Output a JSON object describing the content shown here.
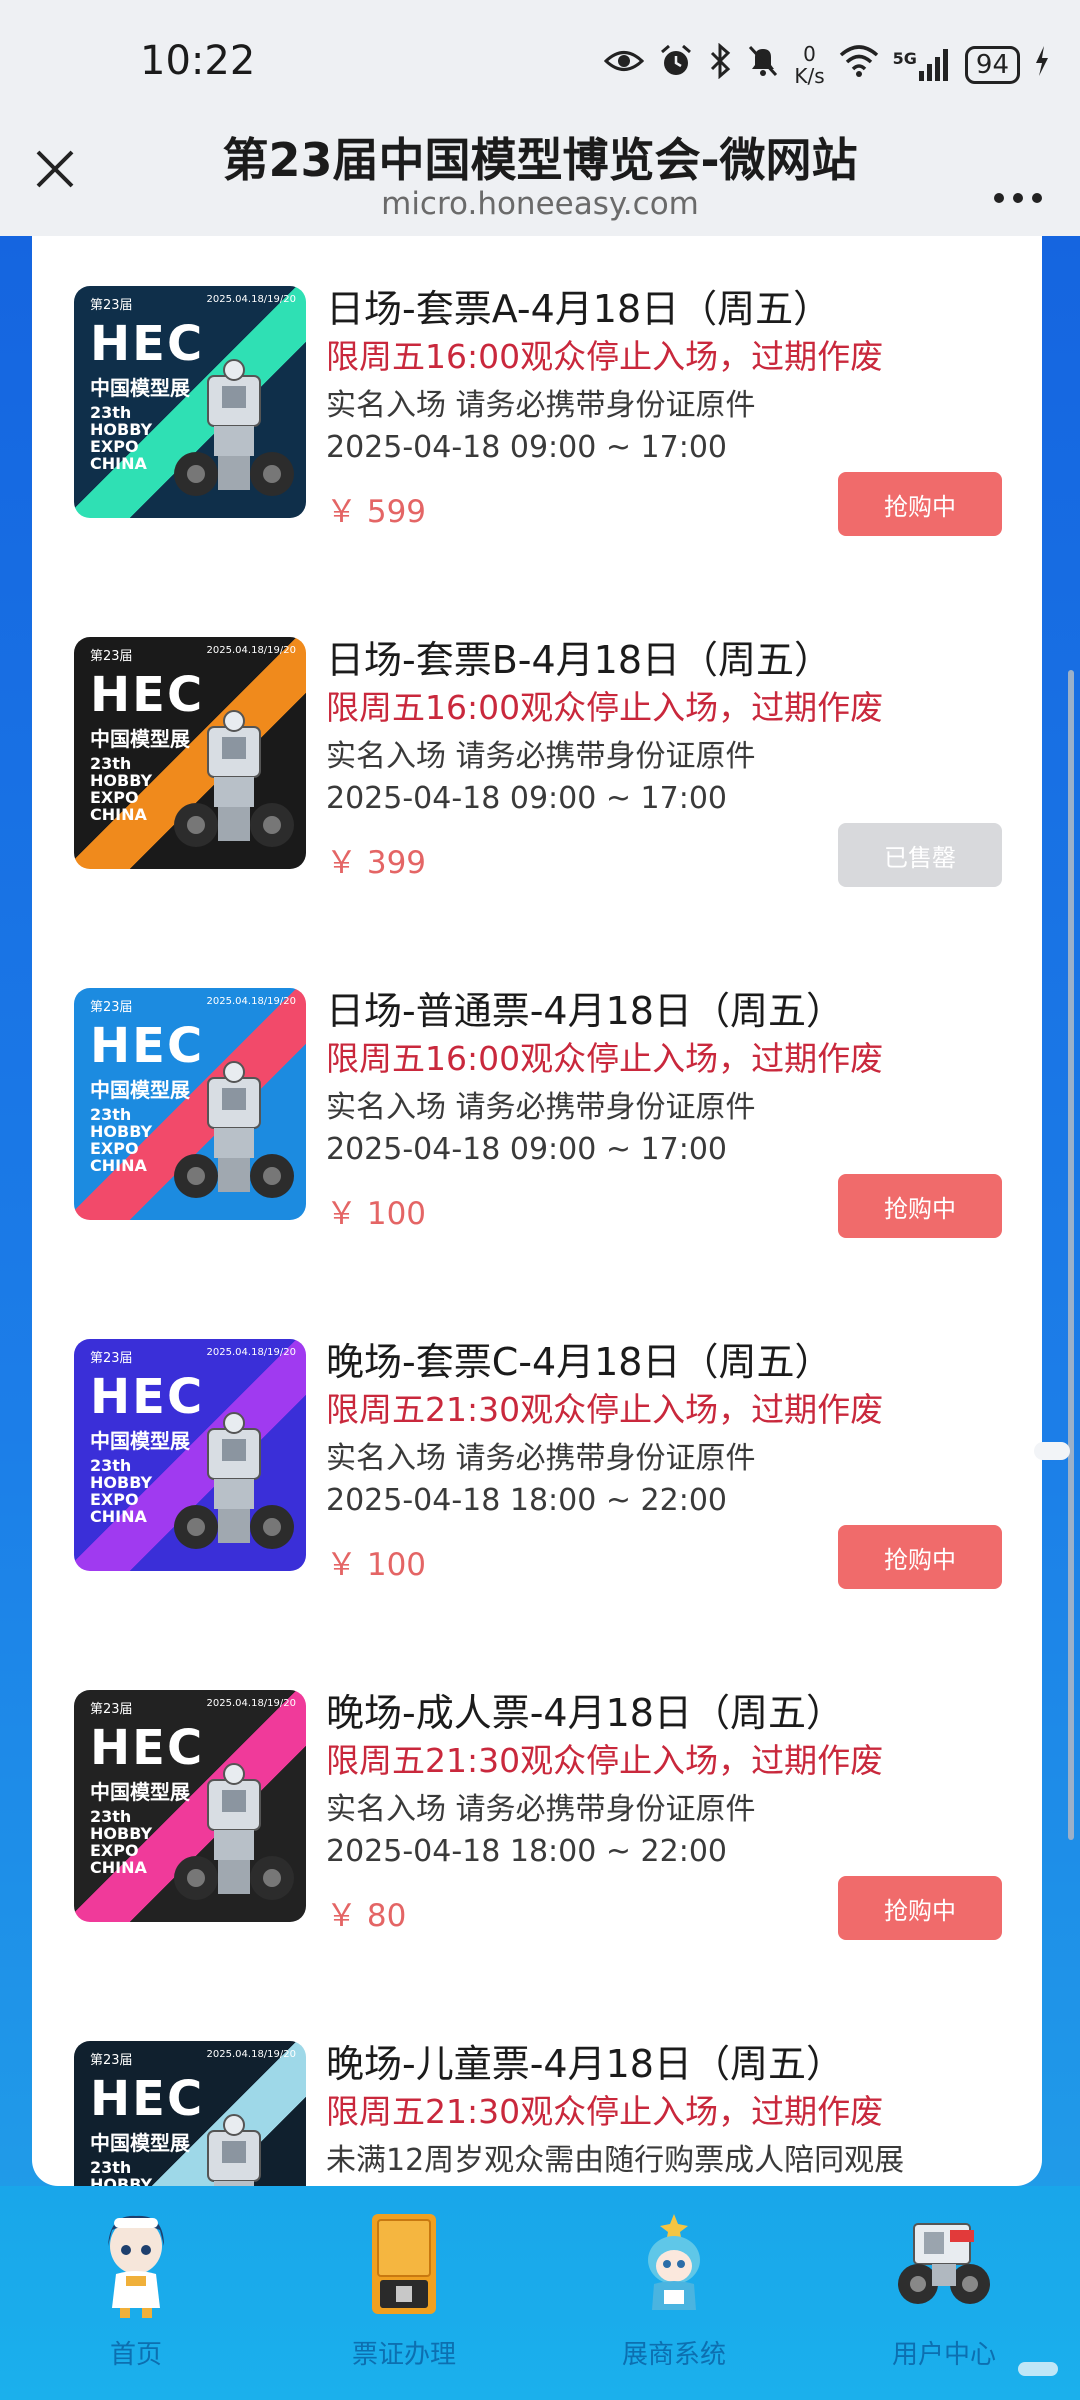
{
  "status_bar": {
    "time": "10:22",
    "net_speed_value": "0",
    "net_speed_unit": "K/s",
    "network_label": "5G",
    "battery": "94",
    "icons": [
      "eye-icon",
      "alarm-icon",
      "bluetooth-icon",
      "mute-icon",
      "wifi-icon",
      "signal-icon",
      "charging-icon"
    ]
  },
  "header": {
    "title": "第23届中国模型博览会-微网站",
    "subtitle": "micro.honeeasy.com"
  },
  "thumbnail": {
    "edition": "第23届",
    "brand": "HEC",
    "brand_cn": "中国模型展",
    "lines": [
      "23th",
      "HOBBY",
      "EXPO",
      "CHINA"
    ],
    "date": "2025.04.18/19/20"
  },
  "tickets": [
    {
      "name": "日场-套票A-4月18日（周五）",
      "notice": "限周五16:00观众停止入场，过期作废",
      "desc": "实名入场 请务必携带身份证原件",
      "datetime": "2025-04-18 09:00 ~ 17:00",
      "price": "￥ 599",
      "button": "抢购中",
      "sold": false,
      "theme": {
        "bg": "#0f2f4a",
        "accent": "#2fe0b4"
      }
    },
    {
      "name": "日场-套票B-4月18日（周五）",
      "notice": "限周五16:00观众停止入场，过期作废",
      "desc": "实名入场 请务必携带身份证原件",
      "datetime": "2025-04-18 09:00 ~ 17:00",
      "price": "￥ 399",
      "button": "已售罄",
      "sold": true,
      "theme": {
        "bg": "#1a1a1a",
        "accent": "#f08a1c"
      }
    },
    {
      "name": "日场-普通票-4月18日（周五）",
      "notice": "限周五16:00观众停止入场，过期作废",
      "desc": "实名入场 请务必携带身份证原件",
      "datetime": "2025-04-18 09:00 ~ 17:00",
      "price": "￥ 100",
      "button": "抢购中",
      "sold": false,
      "theme": {
        "bg": "#1c8be0",
        "accent": "#f24a6a"
      }
    },
    {
      "name": "晚场-套票C-4月18日（周五）",
      "notice": "限周五21:30观众停止入场，过期作废",
      "desc": "实名入场 请务必携带身份证原件",
      "datetime": "2025-04-18 18:00 ~ 22:00",
      "price": "￥ 100",
      "button": "抢购中",
      "sold": false,
      "theme": {
        "bg": "#3a2fd8",
        "accent": "#a03af0"
      }
    },
    {
      "name": "晚场-成人票-4月18日（周五）",
      "notice": "限周五21:30观众停止入场，过期作废",
      "desc": "实名入场 请务必携带身份证原件",
      "datetime": "2025-04-18 18:00 ~ 22:00",
      "price": "￥ 80",
      "button": "抢购中",
      "sold": false,
      "theme": {
        "bg": "#222222",
        "accent": "#f03a9a"
      }
    },
    {
      "name": "晚场-儿童票-4月18日（周五）",
      "notice": "限周五21:30观众停止入场，过期作废",
      "desc": "未满12周岁观众需由随行购票成人陪同观展",
      "datetime": "",
      "price": "",
      "button": "",
      "sold": false,
      "theme": {
        "bg": "#10202e",
        "accent": "#9ed8e8"
      }
    }
  ],
  "bottom_nav": [
    {
      "label": "首页",
      "icon": "girl-mascot-icon"
    },
    {
      "label": "票证办理",
      "icon": "printer-icon"
    },
    {
      "label": "展商系统",
      "icon": "mascot-icon"
    },
    {
      "label": "用户中心",
      "icon": "robot-vehicle-icon"
    }
  ]
}
